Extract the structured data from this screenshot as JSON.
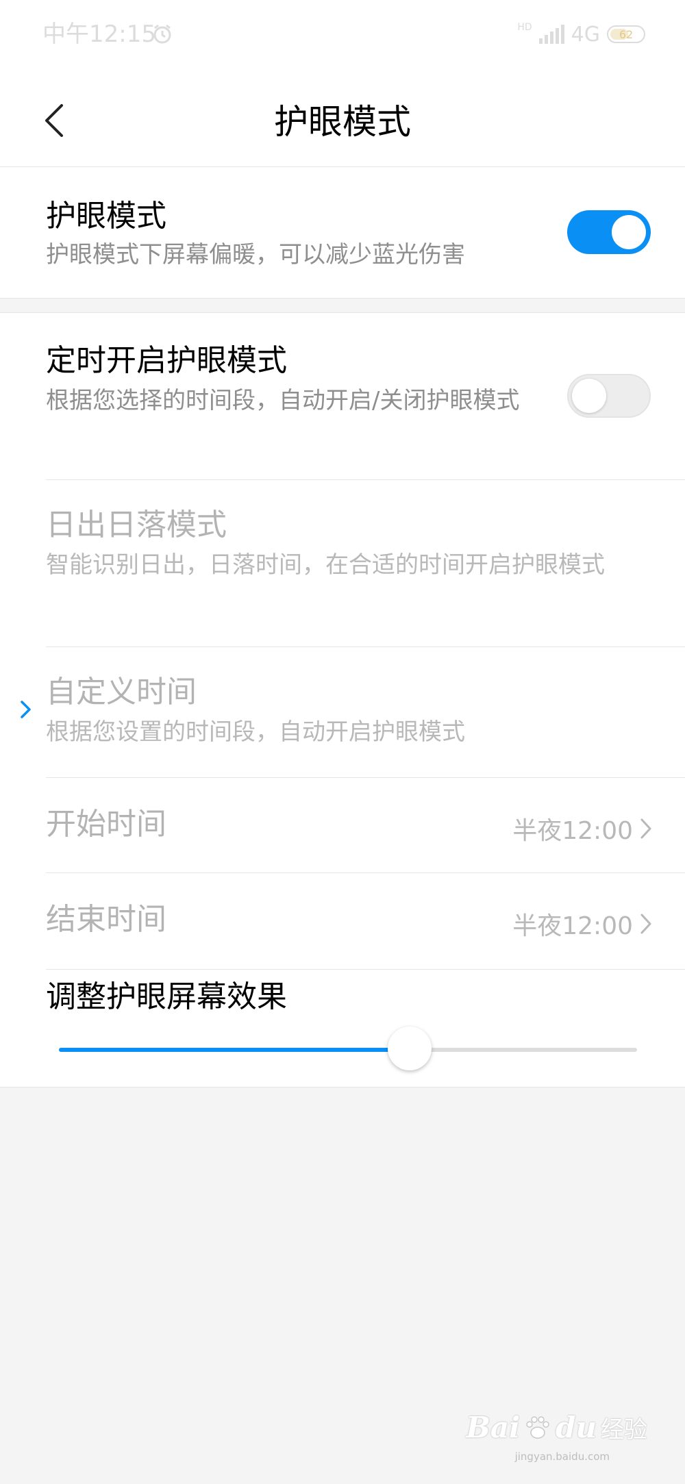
{
  "status_bar": {
    "time": "中午12:15",
    "hd_label": "HD",
    "network": "4G",
    "battery": "62"
  },
  "header": {
    "title": "护眼模式"
  },
  "eye_care": {
    "title": "护眼模式",
    "subtitle": "护眼模式下屏幕偏暖，可以减少蓝光伤害",
    "enabled": true
  },
  "schedule": {
    "title": "定时开启护眼模式",
    "subtitle": "根据您选择的时间段，自动开启/关闭护眼模式",
    "enabled": false
  },
  "sunrise_sunset": {
    "title": "日出日落模式",
    "subtitle": "智能识别日出，日落时间，在合适的时间开启护眼模式"
  },
  "custom_time": {
    "title": "自定义时间",
    "subtitle": "根据您设置的时间段，自动开启护眼模式",
    "selected": true
  },
  "start_time": {
    "label": "开始时间",
    "value": "半夜12:00"
  },
  "end_time": {
    "label": "结束时间",
    "value": "半夜12:00"
  },
  "effect": {
    "title": "调整护眼屏幕效果",
    "level": 0.607
  },
  "watermark": {
    "brand": "Bai",
    "brand_suffix": "du",
    "text": "经验",
    "url": "jingyan.baidu.com"
  },
  "colors": {
    "accent": "#0a8ff5",
    "disabled_text": "#b3b3b3",
    "background": "#f4f4f4"
  }
}
